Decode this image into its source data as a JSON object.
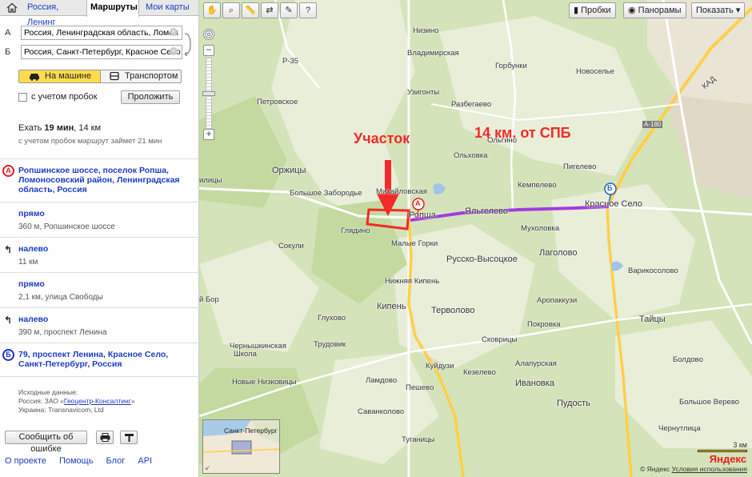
{
  "tabs": {
    "home_icon": "house-icon",
    "items": [
      "Россия, Ленинг",
      "Маршруты",
      "Мои карты"
    ]
  },
  "route": {
    "a_letter": "А",
    "a_value": "Россия, Ленинградская область, Ломон",
    "b_letter": "Б",
    "b_value": "Россия, Санкт-Петербург, Красное Село",
    "mode_car": "На машине",
    "mode_transit": "Транспортом",
    "traffic_label": "с учетом пробок",
    "lay_button": "Проложить",
    "summary_prefix": "Ехать",
    "summary_time": "19 мин",
    "summary_dist": ", 14 км",
    "summary_sub": "с учетом пробок маршрут займет 21 мин"
  },
  "steps": [
    {
      "title": "Ропшинское шоссе, поселок Ропша, Ломоносовский район, Ленинградская область, Россия",
      "detail": ""
    },
    {
      "title": "прямо",
      "detail": "360 м, Ропшинское шоссе"
    },
    {
      "title": "налево",
      "detail": "11 км"
    },
    {
      "title": "прямо",
      "detail": "2,1 км, улица Свободы"
    },
    {
      "title": "налево",
      "detail": "390 м, проспект Ленина"
    },
    {
      "title": "79, проспект Ленина, Красное Село, Санкт-Петербург, Россия",
      "detail": ""
    }
  ],
  "sources": {
    "line1": "Исходные данные:",
    "line2_prefix": "Россия: ЗАО «",
    "line2_link": "Геоцентр-Консалтинг",
    "line2_suffix": "»",
    "line3": "Украина: Transnavicom, Ltd"
  },
  "actions": {
    "report": "Сообщить об ошибке",
    "print_icon": "printer-icon",
    "pin_icon": "pin-icon"
  },
  "footer": [
    "О проекте",
    "Помощь",
    "Блог",
    "API"
  ],
  "map": {
    "toolbar_icons": [
      "hand-icon",
      "magnifier-icon",
      "ruler-icon",
      "route-icon",
      "edit-icon",
      "question-icon"
    ],
    "traffic": "Пробки",
    "panoramas": "Панорамы",
    "show": "Показать",
    "annotation_plot": "Участок",
    "annotation_dist": "14 км. от СПБ",
    "labels": {
      "nizino": "Низино",
      "vladimirskaya": "Владимирская",
      "gorbunki": "Горбунки",
      "novoselye": "Новоселье",
      "r35": "Р-35",
      "petrovskoe": "Петровское",
      "uzhigontovo": "Узигонты",
      "razbegaevo": "Разбегаево",
      "kad": "КАД",
      "a180": "А-180",
      "olhovka": "Ольховка",
      "olgino": "Ольгино",
      "pigelevo": "Пигелево",
      "orzhitsy": "Оржицы",
      "bolshoe_zaborodie": "Большое Забородье",
      "mikhailovskaya": "Михайловская",
      "ropsha": "Ропша",
      "yalgelevo": "Яльгелево",
      "kempelevo": "Кемпелево",
      "muhalovka": "Мухоловка",
      "krasnoe_selo": "Красное Село",
      "gliadino": "Глядино",
      "malye_gorki": "Малые Горки",
      "sokuli": "Сокули",
      "russko_vysotskoe": "Русско-Высоцкое",
      "lagolovo": "Лаголово",
      "varikosolovo": "Варикосолово",
      "nizhnyaya_kipen": "Нижняя Кипень",
      "kipen": "Кипень",
      "tervolovo": "Терволово",
      "aropakkuzi": "Аропаккузи",
      "bor": "й Бор",
      "glukhovo": "Глухово",
      "taitsy": "Тайцы",
      "pokrovka": "Покровка",
      "chernykinskaya": "Чернышкинская",
      "shkola": "Школа",
      "trudovik": "Трудовик",
      "skovritsy": "Сковрицы",
      "kuidusi": "Куйдузи",
      "alapurskaya": "Алапурская",
      "novye_nizkovitsy": "Новые Низковицы",
      "kezelevo": "Кезелево",
      "peshevo": "Пешевo",
      "ivanovka": "Ивановка",
      "lamdovo": "Ламдово",
      "pudost": "Пудость",
      "savankolvo": "Саванколово",
      "tuganicy": "Туганицы",
      "ilicy": "илицы",
      "boldovo": "Болдово",
      "bolshoe_verevo": "Большое Верево",
      "chernitsy": "Чернутлица"
    },
    "zoom_in": "+",
    "zoom_out": "−",
    "minimap_label": "Санкт-Петербург",
    "scale": "3 км",
    "logo": "Яндекс",
    "copyright": "© Яндекс",
    "terms": "Условия использования",
    "marker_a": "А",
    "marker_b": "Б",
    "colors": {
      "route": "#a43be0",
      "annotation": "#f12a2a",
      "road_main": "#ffcf4a",
      "road_secondary": "#ffffff",
      "forest": "#c3d9a0",
      "field": "#e8eed8"
    }
  }
}
